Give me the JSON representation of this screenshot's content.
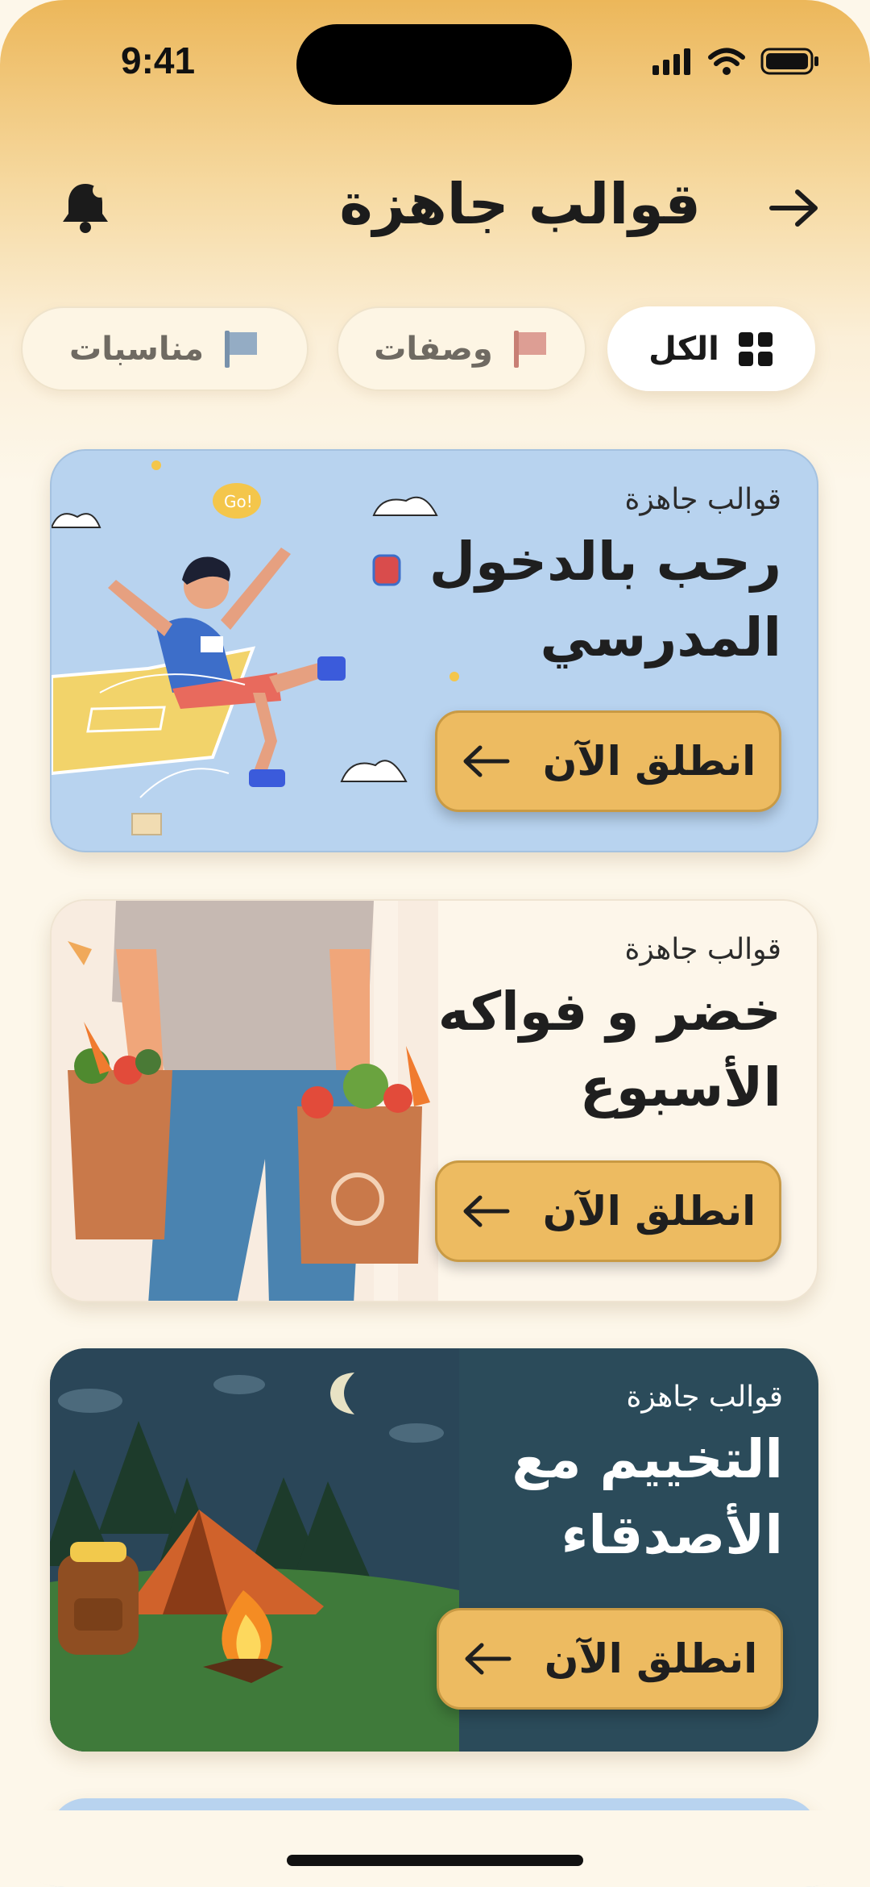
{
  "status_bar": {
    "time": "9:41"
  },
  "header": {
    "title": "قوالب جاهزة"
  },
  "filters": [
    {
      "label": "الكل",
      "icon": "grid-icon",
      "active": true
    },
    {
      "label": "وصفات",
      "icon": "flag-icon",
      "color": "#d6958c"
    },
    {
      "label": "مناسبات",
      "icon": "flag-icon",
      "color": "#8ba5bf"
    }
  ],
  "cards": [
    {
      "kicker": "قوالب جاهزة",
      "title_line1": "رحب بالدخول",
      "title_line2": "المدرسي",
      "button": "انطلق الآن"
    },
    {
      "kicker": "قوالب جاهزة",
      "title_line1": "خضر و فواكه",
      "title_line2": "الأسبوع",
      "button": "انطلق الآن"
    },
    {
      "kicker": "قوالب جاهزة",
      "title_line1": "التخييم مع",
      "title_line2": "الأصدقاء",
      "button": "انطلق الآن"
    }
  ],
  "colors": {
    "accent": "#edbb61",
    "background": "#fdf7ea",
    "camp_card": "#2b4b5a",
    "school_card": "#b8d3ef"
  }
}
